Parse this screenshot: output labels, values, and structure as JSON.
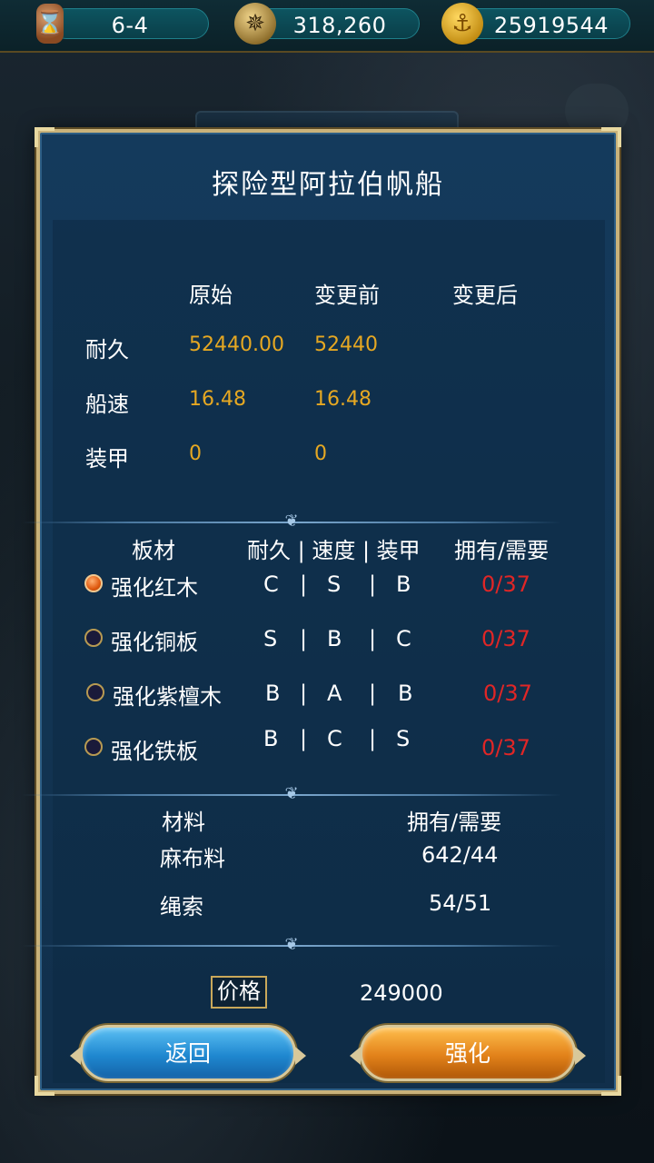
{
  "topbar": {
    "stage": "6-4",
    "compass_value": "318,260",
    "gold_value": "25919544"
  },
  "dialog": {
    "title": "探险型阿拉伯帆船",
    "stats": {
      "headers": [
        "原始",
        "变更前",
        "变更后"
      ],
      "rows": [
        {
          "label": "耐久",
          "original": "52440.00",
          "before": "52440",
          "after": ""
        },
        {
          "label": "船速",
          "original": "16.48",
          "before": "16.48",
          "after": ""
        },
        {
          "label": "装甲",
          "original": "0",
          "before": "0",
          "after": ""
        }
      ]
    },
    "boards": {
      "header_name": "板材",
      "header_grades": "耐久 | 速度 | 装甲",
      "header_owned": "拥有/需要",
      "items": [
        {
          "name": "强化红木",
          "durability": "C",
          "speed": "S",
          "armor": "B",
          "owned": "0/37",
          "selected": true
        },
        {
          "name": "强化铜板",
          "durability": "S",
          "speed": "B",
          "armor": "C",
          "owned": "0/37",
          "selected": false
        },
        {
          "name": "强化紫檀木",
          "durability": "B",
          "speed": "A",
          "armor": "B",
          "owned": "0/37",
          "selected": false
        },
        {
          "name": "强化铁板",
          "durability": "B",
          "speed": "C",
          "armor": "S",
          "owned": "0/37",
          "selected": false
        }
      ]
    },
    "materials": {
      "header_name": "材料",
      "header_owned": "拥有/需要",
      "items": [
        {
          "name": "麻布料",
          "owned": "642/44"
        },
        {
          "name": "绳索",
          "owned": "54/51"
        }
      ]
    },
    "price": {
      "label": "价格",
      "value": "249000"
    },
    "buttons": {
      "back": "返回",
      "enhance": "强化"
    }
  },
  "colors": {
    "panel_bg": "#143a5c",
    "frame_gold": "#c9b27a",
    "value_gold": "#e6a822",
    "shortage_red": "#e02626",
    "button_blue": "#1f88d0",
    "button_orange": "#e2821a"
  },
  "icons": {
    "stage": "hourglass-icon",
    "compass": "compass-icon",
    "gold": "anchor-coin-icon",
    "divider": "fleur-ornament-icon",
    "radio_on": "radio-selected-icon",
    "radio_off": "radio-unselected-icon"
  }
}
